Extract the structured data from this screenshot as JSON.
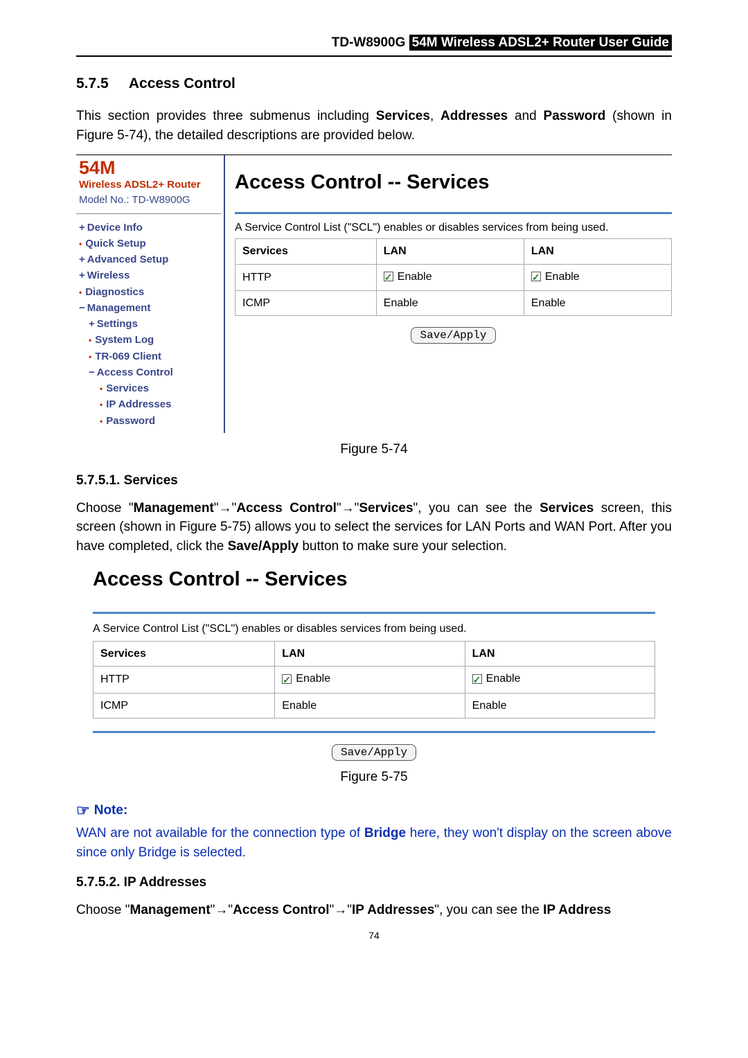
{
  "header": {
    "model": "TD-W8900G",
    "guide": "54M Wireless ADSL2+ Router User Guide"
  },
  "section": {
    "num": "5.7.5",
    "title": "Access Control",
    "intro_pre": "This section provides three submenus including ",
    "intro_w1": "Services",
    "intro_sep1": ", ",
    "intro_w2": "Addresses",
    "intro_sep2": " and ",
    "intro_w3": "Password",
    "intro_post": " (shown in Figure 5-74), the detailed descriptions are provided below."
  },
  "sidebar": {
    "brand1": "54M",
    "brand2": "Wireless ADSL2+ Router",
    "model_line": "Model No.: TD-W8900G",
    "items": [
      {
        "label": "Device Info",
        "lvl": "lvl1",
        "bullet": "bullet-plus",
        "bold": true
      },
      {
        "label": "Quick Setup",
        "lvl": "lvl1",
        "bullet": "bullet-dot",
        "bold": true
      },
      {
        "label": "Advanced Setup",
        "lvl": "lvl1",
        "bullet": "bullet-plus",
        "bold": true
      },
      {
        "label": "Wireless",
        "lvl": "lvl1",
        "bullet": "bullet-plus",
        "bold": true
      },
      {
        "label": "Diagnostics",
        "lvl": "lvl1",
        "bullet": "bullet-dot",
        "bold": true
      },
      {
        "label": "Management",
        "lvl": "lvl1",
        "bullet": "bullet-minus",
        "bold": true
      },
      {
        "label": "Settings",
        "lvl": "lvl2",
        "bullet": "bullet-plus",
        "bold": true
      },
      {
        "label": "System Log",
        "lvl": "lvl2",
        "bullet": "leaf",
        "bold": true
      },
      {
        "label": "TR-069 Client",
        "lvl": "lvl2",
        "bullet": "leaf",
        "bold": true
      },
      {
        "label": "Access Control",
        "lvl": "lvl2",
        "bullet": "bullet-minus",
        "bold": true
      },
      {
        "label": "Services",
        "lvl": "lvl3",
        "bullet": "leaf",
        "bold": true
      },
      {
        "label": "IP Addresses",
        "lvl": "lvl3",
        "bullet": "leaf",
        "bold": true
      },
      {
        "label": "Password",
        "lvl": "lvl3",
        "bullet": "leaf",
        "bold": true
      }
    ]
  },
  "panel": {
    "title": "Access Control -- Services",
    "desc": "A Service Control List (\"SCL\") enables or disables services from being used.",
    "headers": {
      "c1": "Services",
      "c2": "LAN",
      "c3": "LAN"
    },
    "rows": [
      {
        "svc": "HTTP",
        "lan1": "Enable",
        "lan1_chk": true,
        "lan2": "Enable",
        "lan2_chk": true
      },
      {
        "svc": "ICMP",
        "lan1": "Enable",
        "lan1_chk": false,
        "lan2": "Enable",
        "lan2_chk": false
      }
    ],
    "save": "Save/Apply"
  },
  "caption74": "Figure 5-74",
  "sub1": {
    "num": "5.7.5.1.",
    "title": "  Services",
    "p_pre": "Choose \"",
    "w1": "Management",
    "arr": "→",
    "w2": "Access Control",
    "w3": "Services",
    "p_mid1": "\", you can see the ",
    "w4": "Services",
    "p_mid2": " screen, this screen (shown in Figure 5-75) allows you to select the services for LAN Ports and WAN Port. After you have completed, click the ",
    "w5": "Save/Apply",
    "p_post": " button to make sure your selection."
  },
  "panel75": {
    "title": "Access Control -- Services",
    "desc": "A Service Control List (\"SCL\") enables or disables services from being used.",
    "headers": {
      "c1": "Services",
      "c2": "LAN",
      "c3": "LAN"
    },
    "rows": [
      {
        "svc": "HTTP",
        "lan1": "Enable",
        "lan1_chk": true,
        "lan2": "Enable",
        "lan2_chk": true
      },
      {
        "svc": "ICMP",
        "lan1": "Enable",
        "lan1_chk": false,
        "lan2": "Enable",
        "lan2_chk": false
      }
    ],
    "save": "Save/Apply"
  },
  "caption75": "Figure 5-75",
  "note": {
    "heading": "Note:",
    "body_pre": "WAN are not available for the connection type of ",
    "bold": "Bridge",
    "body_post": " here, they won't display on the screen above since only Bridge is selected."
  },
  "sub2": {
    "num": "5.7.5.2.",
    "title": "  IP Addresses",
    "p_pre": "Choose \"",
    "w1": "Management",
    "arr": "→",
    "w2": "Access Control",
    "w3": "IP Addresses",
    "p_mid": "\", you can see the ",
    "w4": "IP Address",
    "p_post": ""
  },
  "page_number": "74"
}
